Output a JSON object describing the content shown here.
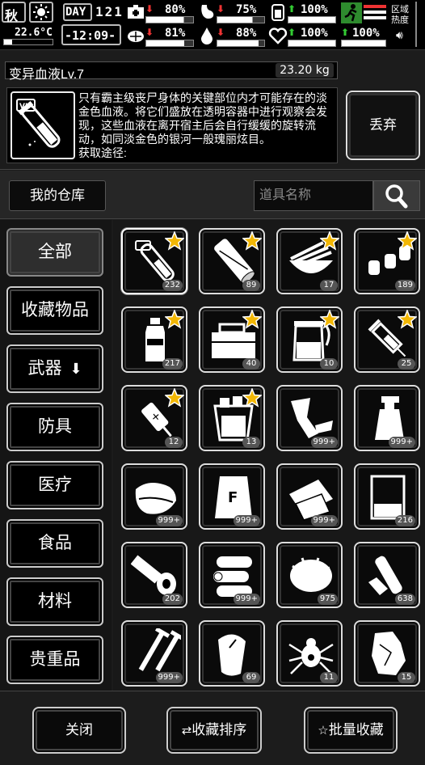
{
  "status": {
    "season": "秋",
    "day_label": "DAY",
    "day": "121",
    "temperature": "22.6°C",
    "time": "-12:09-",
    "region_label": "区域热度",
    "stats": [
      {
        "value": "80%",
        "trend": "down",
        "level": 0.8
      },
      {
        "value": "75%",
        "trend": "down",
        "level": 0.75
      },
      {
        "value": "100%",
        "trend": "up",
        "level": 1.0
      },
      {
        "value": "81%",
        "trend": "down",
        "level": 0.81
      },
      {
        "value": "88%",
        "trend": "down",
        "level": 0.88
      },
      {
        "value": "100%",
        "trend": "up",
        "level": 1.0
      },
      {
        "value": "100%",
        "trend": "up",
        "level": 1.0
      }
    ]
  },
  "item": {
    "name": "变异血液Lv.7",
    "weight": "23.20 kg",
    "description": "只有霸主级丧尸身体的关键部位内才可能存在的淡金色血液。将它们盛放在透明容器中进行观察会发现，这些血液在离开宿主后会自行缓缓的旋转流动，如同淡金色的银河一般瑰丽炫目。",
    "source_label": "获取途径:",
    "icon_badge": "VII",
    "discard_label": "丢弃"
  },
  "warehouse": {
    "label": "我的仓库",
    "search_placeholder": "道具名称"
  },
  "categories": [
    {
      "label": "全部",
      "active": true
    },
    {
      "label": "收藏物品"
    },
    {
      "label": "武器",
      "has_arrow": true
    },
    {
      "label": "防具"
    },
    {
      "label": "医疗"
    },
    {
      "label": "食品"
    },
    {
      "label": "材料"
    },
    {
      "label": "贵重品"
    }
  ],
  "items": [
    {
      "icon": "vial-icon",
      "count": "232",
      "starred": true,
      "selected": true
    },
    {
      "icon": "log-icon",
      "count": "89",
      "starred": true
    },
    {
      "icon": "shell-icon",
      "count": "17",
      "starred": true
    },
    {
      "icon": "bottles-icon",
      "count": "189",
      "starred": true
    },
    {
      "icon": "water-bottle-icon",
      "count": "217",
      "starred": true
    },
    {
      "icon": "toolbox-icon",
      "count": "40",
      "starred": true
    },
    {
      "icon": "specimen-jar-icon",
      "count": "10",
      "starred": true
    },
    {
      "icon": "syringe-icon",
      "count": "25",
      "starred": true
    },
    {
      "icon": "injector-icon",
      "count": "12",
      "starred": true
    },
    {
      "icon": "ice-bucket-icon",
      "count": "13",
      "starred": true
    },
    {
      "icon": "scrap-metal-icon",
      "count": "999+"
    },
    {
      "icon": "spray-bottle-icon",
      "count": "999+"
    },
    {
      "icon": "cloth-icon",
      "count": "999+"
    },
    {
      "icon": "fertilizer-bag-icon",
      "count": "999+"
    },
    {
      "icon": "paper-sheets-icon",
      "count": "999+"
    },
    {
      "icon": "beaker-icon",
      "count": "216"
    },
    {
      "icon": "bandage-roll-icon",
      "count": "202"
    },
    {
      "icon": "wood-logs-icon",
      "count": "999+"
    },
    {
      "icon": "fur-icon",
      "count": "975"
    },
    {
      "icon": "plastic-bottles-icon",
      "count": "638"
    },
    {
      "icon": "nails-icon",
      "count": "999+"
    },
    {
      "icon": "mouse-icon",
      "count": "69"
    },
    {
      "icon": "spider-icon",
      "count": "11"
    },
    {
      "icon": "crystal-icon",
      "count": "15"
    }
  ],
  "footer": {
    "close_label": "关闭",
    "sort_label": "收藏排序",
    "batch_label": "批量收藏"
  }
}
